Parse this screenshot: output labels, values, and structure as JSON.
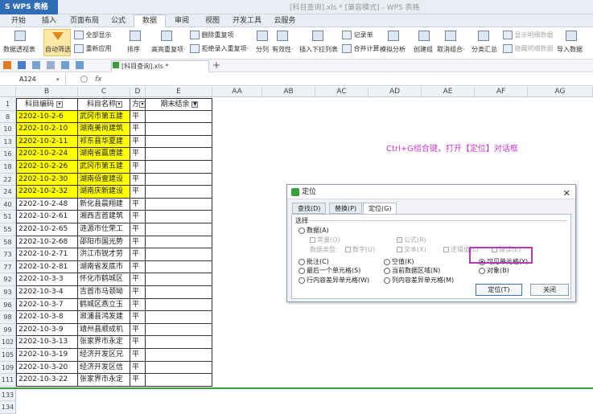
{
  "app": {
    "logo": "S WPS 表格",
    "window_title": "[科目查询].xls * [兼容模式] - WPS 表格"
  },
  "menu": [
    "开始",
    "插入",
    "页面布局",
    "公式",
    "数据",
    "审阅",
    "视图",
    "开发工具",
    "云服务"
  ],
  "menu_active": "数据",
  "ribbon": {
    "pivot": "数据透视表",
    "autofilter": "自动筛选",
    "show_all": "全部显示",
    "reapply": "重新应用",
    "sort": "排序",
    "highlight_dup": "高亮重复项·",
    "delete_dup": "删除重复项",
    "reject_dup": "拒绝录入重复项·",
    "split": "分列",
    "validity": "有效性·",
    "dropdown": "插入下拉列表",
    "record": "记录单",
    "merge_calc": "合并计算",
    "sim": "模拟分析",
    "create_group": "创建组",
    "ungroup": "取消组合·",
    "subtotal": "分类汇总",
    "show_detail": "显示明细数据",
    "hide_detail": "隐藏明细数据",
    "import": "导入数据"
  },
  "doc_tab": "[科目查询].xls *",
  "formula": {
    "name_box": "A124",
    "fx": "fx"
  },
  "columns": [
    "B",
    "C",
    "D",
    "E",
    "AA",
    "AB",
    "AC",
    "AD",
    "AE",
    "AF",
    "AG"
  ],
  "header_row": {
    "num": "1",
    "b": "科目编码",
    "c": "科目名称",
    "d": "方",
    "e": "期末结余"
  },
  "rows": [
    {
      "num": "8",
      "code": "2202-10-2-6",
      "name": "武冈市第五建",
      "dir": "平",
      "yellow": true
    },
    {
      "num": "10",
      "code": "2202-10-2-10",
      "name": "湖南美尚建筑",
      "dir": "平",
      "yellow": true
    },
    {
      "num": "13",
      "code": "2202-10-2-11",
      "name": "祁东县华夏建",
      "dir": "平",
      "yellow": true
    },
    {
      "num": "16",
      "code": "2202-10-2-24",
      "name": "湖南省赢唐建",
      "dir": "平",
      "yellow": true
    },
    {
      "num": "18",
      "code": "2202-10-2-26",
      "name": "武冈市第五建",
      "dir": "平",
      "yellow": true
    },
    {
      "num": "22",
      "code": "2202-10-2-30",
      "name": "湖南佰壹建设",
      "dir": "平",
      "yellow": true
    },
    {
      "num": "24",
      "code": "2202-10-2-32",
      "name": "湖南庆新建设",
      "dir": "平",
      "yellow": true
    },
    {
      "num": "40",
      "code": "2202-10-2-48",
      "name": "新化县晨翔建",
      "dir": "平",
      "yellow": false
    },
    {
      "num": "51",
      "code": "2202-10-2-61",
      "name": "湘西吉首建筑",
      "dir": "平",
      "yellow": false
    },
    {
      "num": "55",
      "code": "2202-10-2-65",
      "name": "涟源市仕荣工",
      "dir": "平",
      "yellow": false
    },
    {
      "num": "58",
      "code": "2202-10-2-68",
      "name": "邵阳市国光势",
      "dir": "平",
      "yellow": false
    },
    {
      "num": "73",
      "code": "2202-10-2-71",
      "name": "洪江市锐才劳",
      "dir": "平",
      "yellow": false
    },
    {
      "num": "77",
      "code": "2202-10-2-81",
      "name": "湖南省发底市",
      "dir": "平",
      "yellow": false
    },
    {
      "num": "92",
      "code": "2202-10-3-3",
      "name": "怀化市鹤城区",
      "dir": "平",
      "yellow": false
    },
    {
      "num": "93",
      "code": "2202-10-3-4",
      "name": "吉首市马颈坳",
      "dir": "平",
      "yellow": false
    },
    {
      "num": "96",
      "code": "2202-10-3-7",
      "name": "鹤城区燕立玉",
      "dir": "平",
      "yellow": false
    },
    {
      "num": "98",
      "code": "2202-10-3-8",
      "name": "溆浦县鸿发建",
      "dir": "平",
      "yellow": false
    },
    {
      "num": "99",
      "code": "2202-10-3-9",
      "name": "靖州县顺成机",
      "dir": "平",
      "yellow": false
    },
    {
      "num": "102",
      "code": "2202-10-3-13",
      "name": "张家界市永定",
      "dir": "平",
      "yellow": false
    },
    {
      "num": "105",
      "code": "2202-10-3-19",
      "name": "经济开发区兄",
      "dir": "平",
      "yellow": false
    },
    {
      "num": "109",
      "code": "2202-10-3-20",
      "name": "经济开发区信",
      "dir": "平",
      "yellow": false
    },
    {
      "num": "111",
      "code": "2202-10-3-22",
      "name": "张家界市永定",
      "dir": "平",
      "yellow": false
    }
  ],
  "trail_rows": [
    "133",
    "134"
  ],
  "note": "Ctrl+G组合键，打开【定位】对话框",
  "dialog": {
    "title": "定位",
    "tabs": [
      "查找(D)",
      "替换(P)",
      "定位(G)"
    ],
    "group": "选择",
    "data_opt": "数据(A)",
    "constant": "常量(O)",
    "formula": "公式(R)",
    "data_type": "数据类型:",
    "number": "数字(U)",
    "text": "文本(X)",
    "logic": "逻辑值(L)",
    "error": "错误(E)",
    "comment": "批注(C)",
    "null_val": "空值(K)",
    "visible": "可见单元格(Y)",
    "last_cell": "最后一个单元格(S)",
    "current_region": "当前数据区域(N)",
    "objects": "对象(B)",
    "row_diff": "行内容差异单元格(W)",
    "col_diff": "列内容差异单元格(M)",
    "ok": "定位(T)",
    "close": "关闭"
  }
}
